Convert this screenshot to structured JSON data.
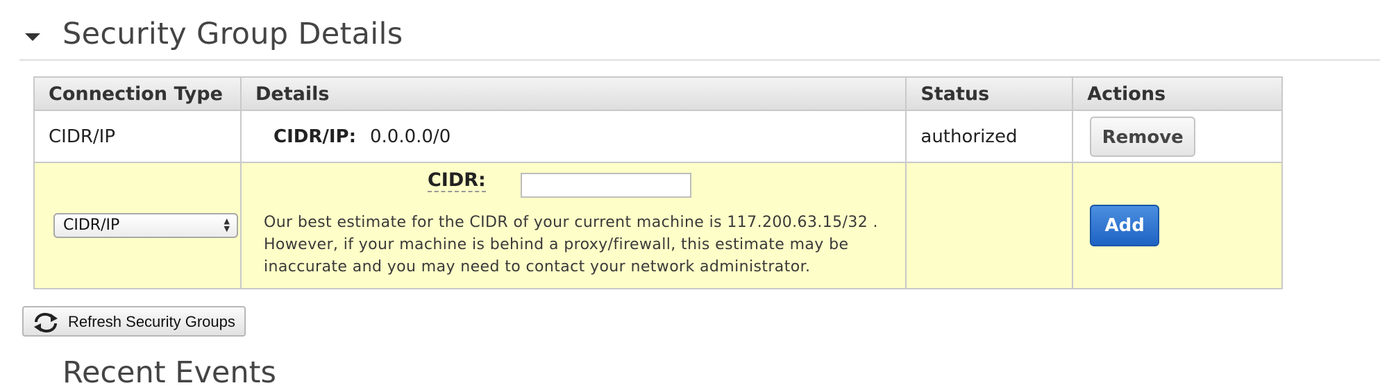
{
  "section": {
    "title": "Security Group Details"
  },
  "table": {
    "headers": [
      "Connection Type",
      "Details",
      "Status",
      "Actions"
    ],
    "existing_rule": {
      "connection_type": "CIDR/IP",
      "details_label": "CIDR/IP:",
      "details_value": "0.0.0.0/0",
      "status": "authorized",
      "action_label": "Remove"
    },
    "new_rule": {
      "connection_type_selected": "CIDR/IP",
      "cidr_label": "CIDR:",
      "cidr_value": "",
      "estimate_text": "Our best estimate for the CIDR of your current machine is 117.200.63.15/32 . However, if your machine is behind a proxy/firewall, this estimate may be inaccurate and you may need to contact your network administrator.",
      "status": "",
      "action_label": "Add"
    }
  },
  "refresh_button": {
    "label": "Refresh Security Groups",
    "icon": "refresh-icon"
  },
  "next_section": {
    "title": "Recent Events"
  },
  "colors": {
    "new_row_bg": "#fefec8",
    "add_button": "#1f63c3",
    "header_bg": "#e6e6e6"
  }
}
